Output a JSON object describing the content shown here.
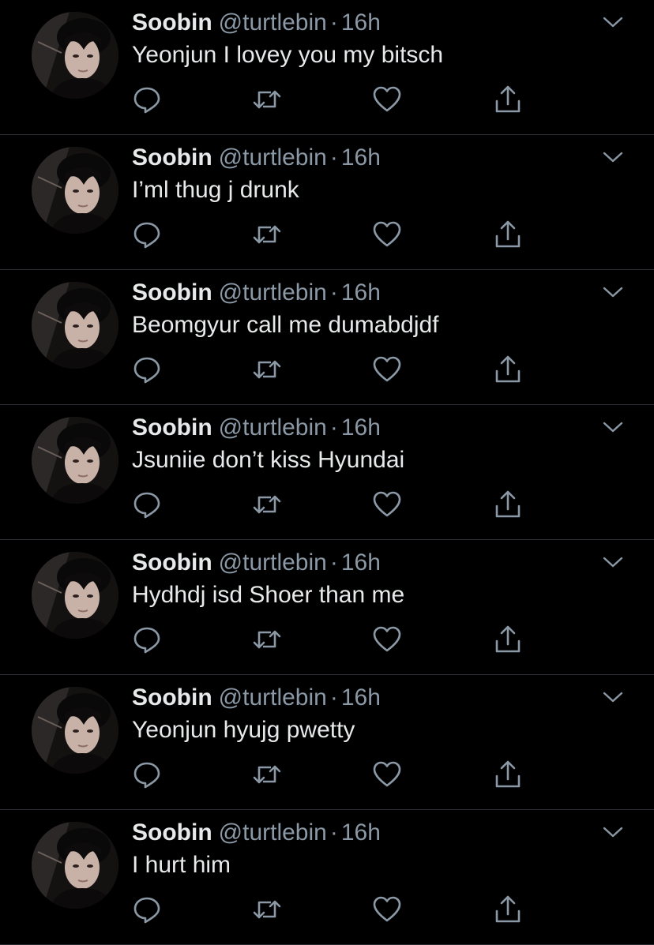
{
  "colors": {
    "background": "#000000",
    "primary_text": "#e7e9ea",
    "secondary_text": "#8b98a5",
    "icon": "#8b98a5",
    "divider": "#2a2d31"
  },
  "icons": {
    "reply": "reply-icon",
    "retweet": "retweet-icon",
    "like": "like-icon",
    "share": "share-icon",
    "more": "chevron-down-icon"
  },
  "tweets": [
    {
      "name": "Soobin",
      "handle": "@turtlebin",
      "separator": "·",
      "time": "16h",
      "text": "Yeonjun I lovey you my bitsch"
    },
    {
      "name": "Soobin",
      "handle": "@turtlebin",
      "separator": "·",
      "time": "16h",
      "text": "I’ml thug j drunk"
    },
    {
      "name": "Soobin",
      "handle": "@turtlebin",
      "separator": "·",
      "time": "16h",
      "text": "Beomgyur call me dumabdjdf"
    },
    {
      "name": "Soobin",
      "handle": "@turtlebin",
      "separator": "·",
      "time": "16h",
      "text": "Jsuniie don’t kiss Hyundai"
    },
    {
      "name": "Soobin",
      "handle": "@turtlebin",
      "separator": "·",
      "time": "16h",
      "text": "Hydhdj isd Shoer than me"
    },
    {
      "name": "Soobin",
      "handle": "@turtlebin",
      "separator": "·",
      "time": "16h",
      "text": "Yeonjun hyujg pwetty"
    },
    {
      "name": "Soobin",
      "handle": "@turtlebin",
      "separator": "·",
      "time": "16h",
      "text": "I hurt him"
    }
  ]
}
